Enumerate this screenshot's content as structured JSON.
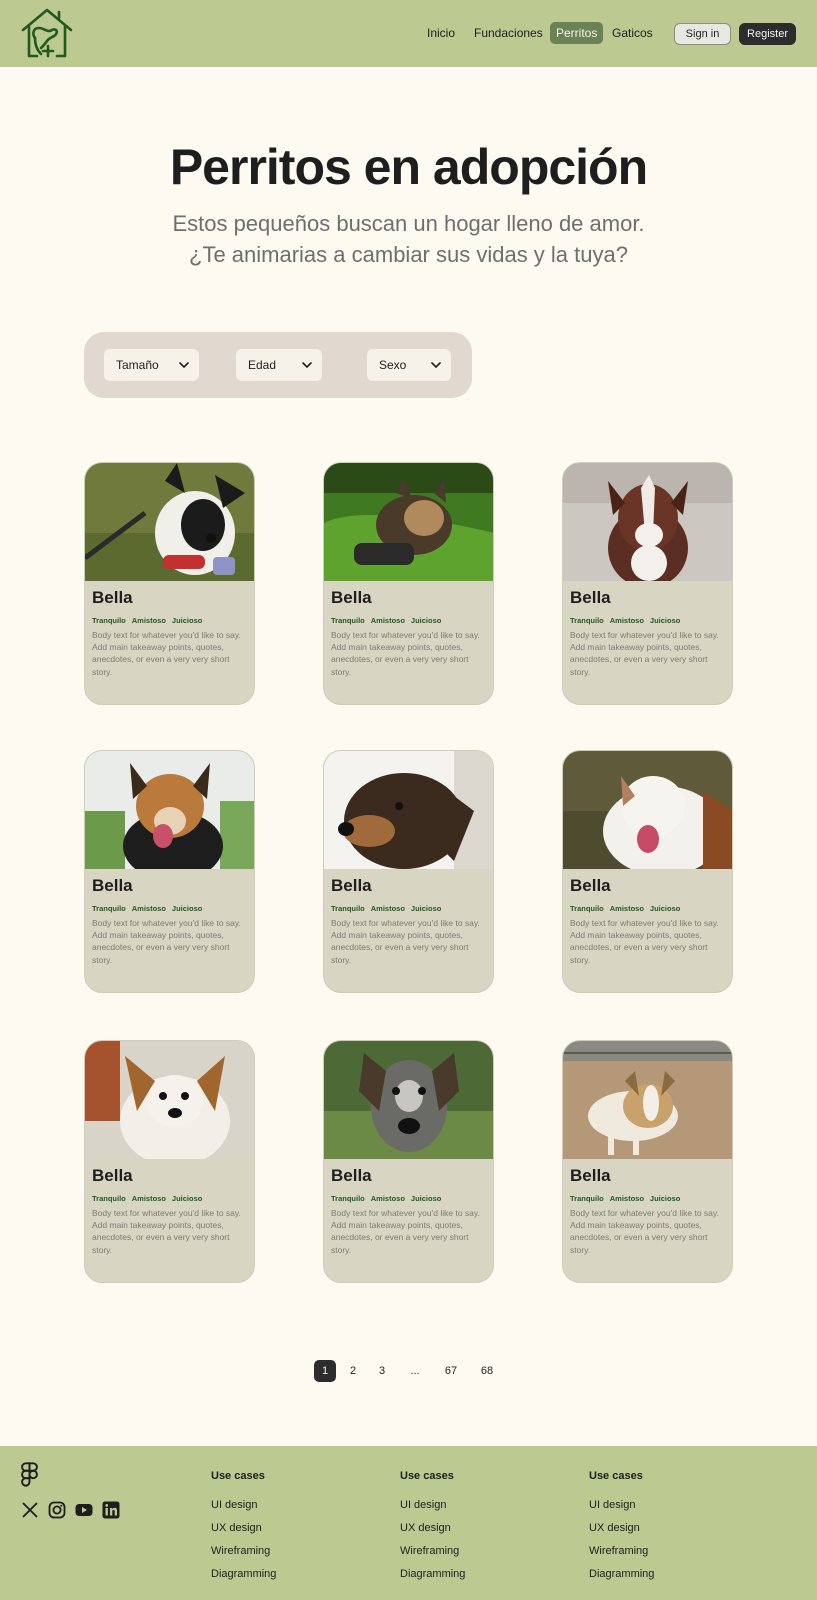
{
  "header": {
    "nav": [
      "Inicio",
      "Fundaciones",
      "Perritos",
      "Gaticos"
    ],
    "active_nav": "Perritos",
    "signin_label": "Sign in",
    "register_label": "Register"
  },
  "hero": {
    "title": "Perritos en adopción",
    "subtitle_line1": "Estos pequeños buscan un hogar lleno de amor.",
    "subtitle_line2": "¿Te animarias a cambiar sus vidas y la tuya?"
  },
  "filters": [
    {
      "label": "Tamaño"
    },
    {
      "label": "Edad"
    },
    {
      "label": "Sexo"
    }
  ],
  "cards": [
    {
      "name": "Bella",
      "tags": [
        "Tranquilo",
        "Amistoso",
        "Juicioso"
      ],
      "body": "Body text for whatever you'd like to say. Add main takeaway points, quotes, anecdotes, or even a very very short story."
    },
    {
      "name": "Bella",
      "tags": [
        "Tranquilo",
        "Amistoso",
        "Juicioso"
      ],
      "body": "Body text for whatever you'd like to say. Add main takeaway points, quotes, anecdotes, or even a very very short story."
    },
    {
      "name": "Bella",
      "tags": [
        "Tranquilo",
        "Amistoso",
        "Juicioso"
      ],
      "body": "Body text for whatever you'd like to say. Add main takeaway points, quotes, anecdotes, or even a very very short story."
    },
    {
      "name": "Bella",
      "tags": [
        "Tranquilo",
        "Amistoso",
        "Juicioso"
      ],
      "body": "Body text for whatever you'd like to say. Add main takeaway points, quotes, anecdotes, or even a very very short story."
    },
    {
      "name": "Bella",
      "tags": [
        "Tranquilo",
        "Amistoso",
        "Juicioso"
      ],
      "body": "Body text for whatever you'd like to say. Add main takeaway points, quotes, anecdotes, or even a very very short story."
    },
    {
      "name": "Bella",
      "tags": [
        "Tranquilo",
        "Amistoso",
        "Juicioso"
      ],
      "body": "Body text for whatever you'd like to say. Add main takeaway points, quotes, anecdotes, or even a very very short story."
    },
    {
      "name": "Bella",
      "tags": [
        "Tranquilo",
        "Amistoso",
        "Juicioso"
      ],
      "body": "Body text for whatever you'd like to say. Add main takeaway points, quotes, anecdotes, or even a very very short story."
    },
    {
      "name": "Bella",
      "tags": [
        "Tranquilo",
        "Amistoso",
        "Juicioso"
      ],
      "body": "Body text for whatever you'd like to say. Add main takeaway points, quotes, anecdotes, or even a very very short story."
    },
    {
      "name": "Bella",
      "tags": [
        "Tranquilo",
        "Amistoso",
        "Juicioso"
      ],
      "body": "Body text for whatever you'd like to say. Add main takeaway points, quotes, anecdotes, or even a very very short story."
    }
  ],
  "pagination": {
    "pages": [
      "1",
      "2",
      "3",
      "...",
      "67",
      "68"
    ],
    "current": "1"
  },
  "footer": {
    "columns": [
      {
        "title": "Use cases",
        "links": [
          "UI design",
          "UX design",
          "Wireframing",
          "Diagramming"
        ]
      },
      {
        "title": "Use cases",
        "links": [
          "UI design",
          "UX design",
          "Wireframing",
          "Diagramming"
        ]
      },
      {
        "title": "Use cases",
        "links": [
          "UI design",
          "UX design",
          "Wireframing",
          "Diagramming"
        ]
      }
    ],
    "social_icons": [
      "x-icon",
      "instagram-icon",
      "youtube-icon",
      "linkedin-icon"
    ]
  },
  "colors": {
    "header_bg": "#bcc991",
    "page_bg": "#fdfbf1",
    "active_nav_bg": "#6b8254",
    "card_bg": "#d8d6c2",
    "tag_color": "#1f5a1f",
    "filter_bar_bg": "#e1d8cf"
  }
}
